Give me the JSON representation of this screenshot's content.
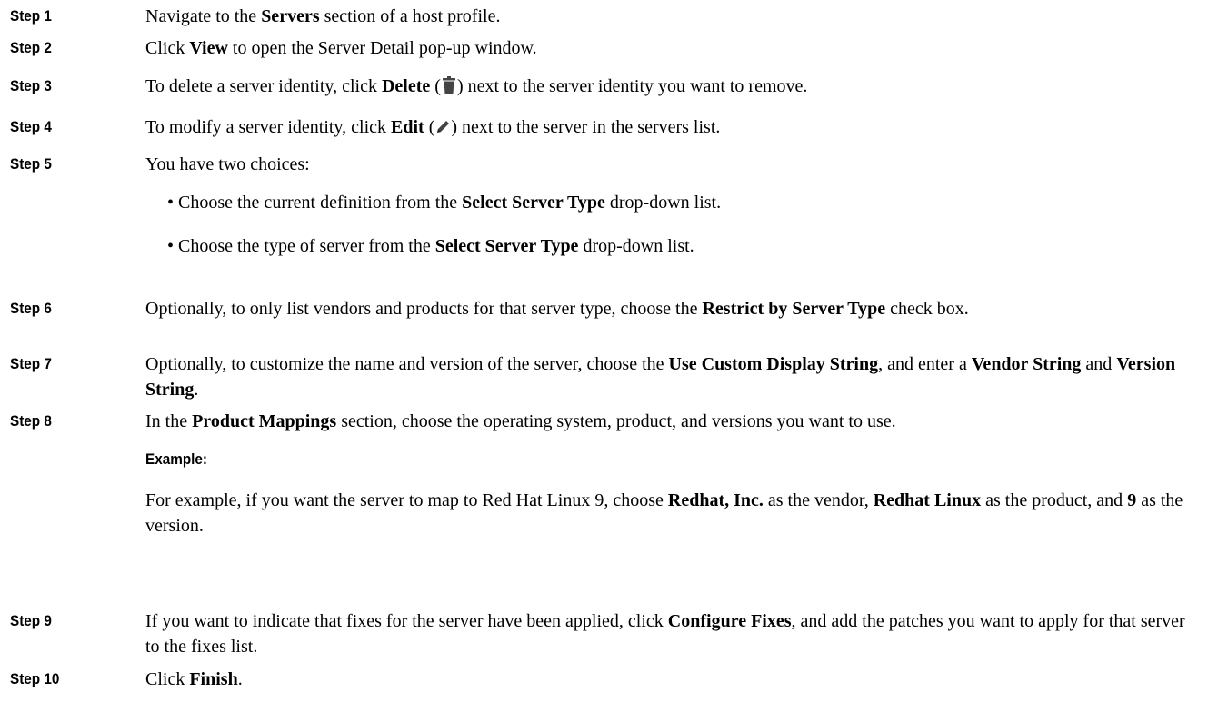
{
  "steps": [
    {
      "label": "Step 1",
      "parts": [
        "Navigate to the ",
        "Servers",
        " section of a host profile."
      ]
    },
    {
      "label": "Step 2",
      "parts": [
        "Click ",
        "View",
        " to open the Server Detail pop-up window."
      ]
    },
    {
      "label": "Step 3",
      "parts": [
        "To delete a server identity, click ",
        "Delete",
        " (",
        ") next to the server identity you want to remove."
      ]
    },
    {
      "label": "Step 4",
      "parts": [
        "To modify a server identity, click ",
        "Edit",
        " (",
        ") next to the server in the servers list."
      ]
    },
    {
      "label": "Step 5",
      "parts": [
        "You have two choices:"
      ],
      "bullets": [
        [
          "• Choose the current definition from the ",
          "Select Server Type",
          " drop-down list."
        ],
        [
          "• Choose the type of server from the ",
          "Select Server Type",
          " drop-down list."
        ]
      ]
    },
    {
      "label": "Step 6",
      "parts": [
        "Optionally, to only list vendors and products for that server type, choose the ",
        "Restrict by Server Type",
        " check box."
      ]
    },
    {
      "label": "Step 7",
      "parts": [
        "Optionally, to customize the name and version of the server, choose the ",
        "Use Custom Display String",
        ", and enter a ",
        "Vendor String",
        " and ",
        "Version String",
        "."
      ]
    },
    {
      "label": "Step 8",
      "parts": [
        "In the ",
        "Product Mappings",
        " section, choose the operating system, product, and versions you want to use."
      ],
      "example_label": "Example:",
      "example_parts": [
        "For example, if you want the server to map to Red Hat Linux 9, choose ",
        "Redhat, Inc.",
        " as the vendor, ",
        "Redhat Linux",
        " as the product, and ",
        "9",
        " as the version."
      ]
    },
    {
      "label": "Step 9",
      "parts": [
        "If you want to indicate that fixes for the server have been applied, click ",
        "Configure Fixes",
        ", and add the patches you want to apply for that server to the fixes list."
      ]
    },
    {
      "label": "Step 10",
      "parts": [
        "Click ",
        "Finish",
        "."
      ]
    }
  ],
  "icons": {
    "step3": "trash-icon",
    "step4": "pencil-icon"
  }
}
